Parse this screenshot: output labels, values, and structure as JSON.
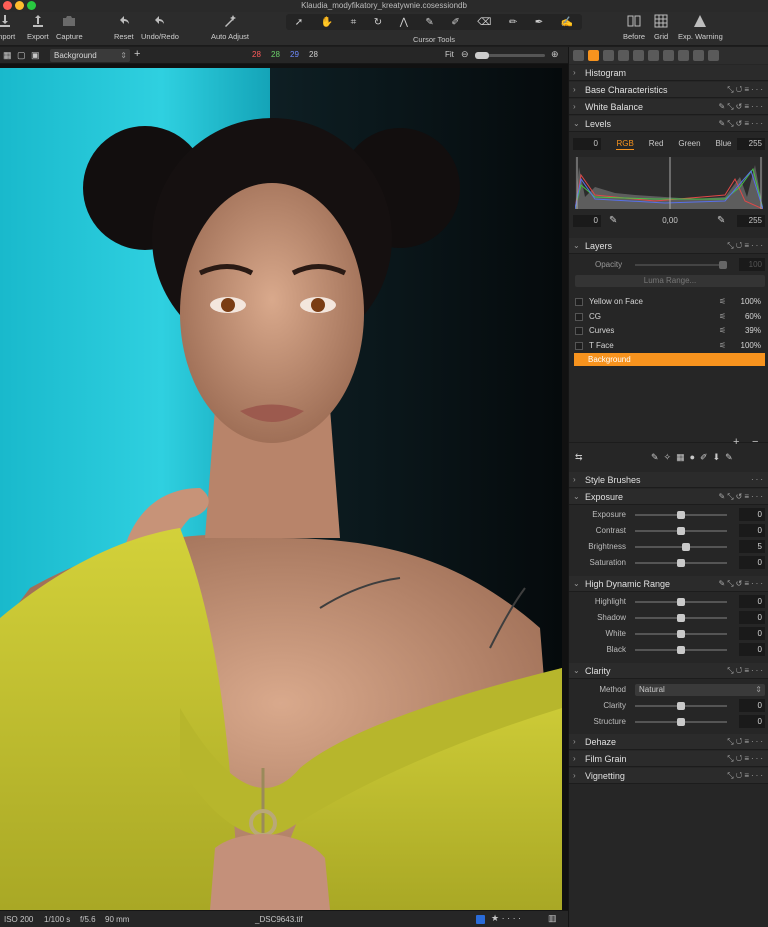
{
  "window": {
    "title": "Klaudia_modyfikatory_kreatywnie.cosessiondb"
  },
  "toolbar": {
    "import": "Import",
    "export": "Export",
    "capture": "Capture",
    "reset": "Reset",
    "undo_redo": "Undo/Redo",
    "auto_adjust": "Auto Adjust",
    "cursor_tools": "Cursor Tools",
    "before": "Before",
    "grid": "Grid",
    "exp_warning": "Exp. Warning"
  },
  "subbar": {
    "layer_select": "Background",
    "r": "28",
    "g": "28",
    "b": "29",
    "l": "28",
    "fit": "Fit"
  },
  "status": {
    "iso": "ISO 200",
    "shutter": "1/100 s",
    "aperture": "f/5.6",
    "focal": "90 mm",
    "filename": "_DSC9643.tif"
  },
  "panel": {
    "histogram": "Histogram",
    "base_characteristics": "Base Characteristics",
    "white_balance": "White Balance",
    "levels": {
      "title": "Levels",
      "tabs": [
        "RGB",
        "Red",
        "Green",
        "Blue"
      ],
      "in_low": "0",
      "in_high": "255",
      "out_low": "0",
      "mid": "0,00",
      "out_high": "255"
    },
    "layers": {
      "title": "Layers",
      "opacity_label": "Opacity",
      "opacity_value": "100",
      "luma_range": "Luma Range...",
      "items": [
        {
          "name": "Yellow on Face",
          "value": "100%"
        },
        {
          "name": "CG",
          "value": "60%"
        },
        {
          "name": "Curves",
          "value": "39%"
        },
        {
          "name": "T Face",
          "value": "100%"
        },
        {
          "name": "Background",
          "value": ""
        }
      ]
    },
    "style_brushes": "Style Brushes",
    "exposure": {
      "title": "Exposure",
      "rows": [
        {
          "label": "Exposure",
          "value": "0",
          "pos": 0.5
        },
        {
          "label": "Contrast",
          "value": "0",
          "pos": 0.5
        },
        {
          "label": "Brightness",
          "value": "5",
          "pos": 0.55
        },
        {
          "label": "Saturation",
          "value": "0",
          "pos": 0.5
        }
      ]
    },
    "hdr": {
      "title": "High Dynamic Range",
      "rows": [
        {
          "label": "Highlight",
          "value": "0",
          "pos": 0.5
        },
        {
          "label": "Shadow",
          "value": "0",
          "pos": 0.5
        },
        {
          "label": "White",
          "value": "0",
          "pos": 0.5
        },
        {
          "label": "Black",
          "value": "0",
          "pos": 0.5
        }
      ]
    },
    "clarity": {
      "title": "Clarity",
      "method_label": "Method",
      "method_value": "Natural",
      "rows": [
        {
          "label": "Clarity",
          "value": "0",
          "pos": 0.5
        },
        {
          "label": "Structure",
          "value": "0",
          "pos": 0.5
        }
      ]
    },
    "dehaze": "Dehaze",
    "film_grain": "Film Grain",
    "vignetting": "Vignetting"
  },
  "colors": {
    "accent": "#f7931e",
    "cyan_bg": "#22c8dc",
    "sweater": "#c8c832"
  }
}
